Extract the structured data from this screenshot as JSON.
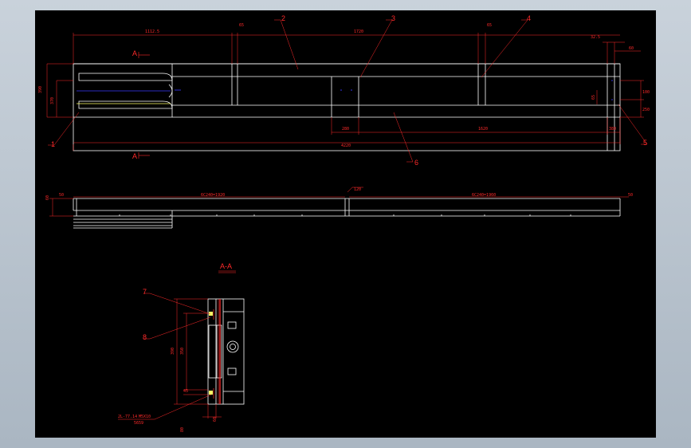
{
  "drawing": {
    "section_marker_top": "A",
    "section_marker_bottom": "A",
    "section_title": "A-A",
    "balloons": [
      "1",
      "2",
      "3",
      "4",
      "5",
      "6",
      "7",
      "8"
    ],
    "dims_top": {
      "d1": "1112.5",
      "d2": "65",
      "d3": "1720",
      "d4": "65",
      "d5": "32.5",
      "d6": "60"
    },
    "dims_left": {
      "h1": "390",
      "h2": "370"
    },
    "dims_right": {
      "r1": "100",
      "r2": "65",
      "r3": "250"
    },
    "dims_bottom": {
      "b1": "280",
      "b2": "1620",
      "b3": "380",
      "b4": "4220"
    },
    "dims_elev": {
      "e1": "60",
      "e2": "50",
      "e3": "6C240=1920",
      "e4": "6C240=1960",
      "e5": "120",
      "e6": "50"
    },
    "dims_section": {
      "s1": "390",
      "s2": "350",
      "s3": "45",
      "s4": "80",
      "s5": "60",
      "note1": "2L-77.14",
      "note2": "M5X10",
      "note3": "5659"
    }
  },
  "colors": {
    "background_frame": "#b7c2cd",
    "drawing_bg": "#000000",
    "outline": "#ffffff",
    "dimension": "#ff2a2a",
    "highlight": "#ffff66",
    "hidden": "#3a3aff"
  }
}
